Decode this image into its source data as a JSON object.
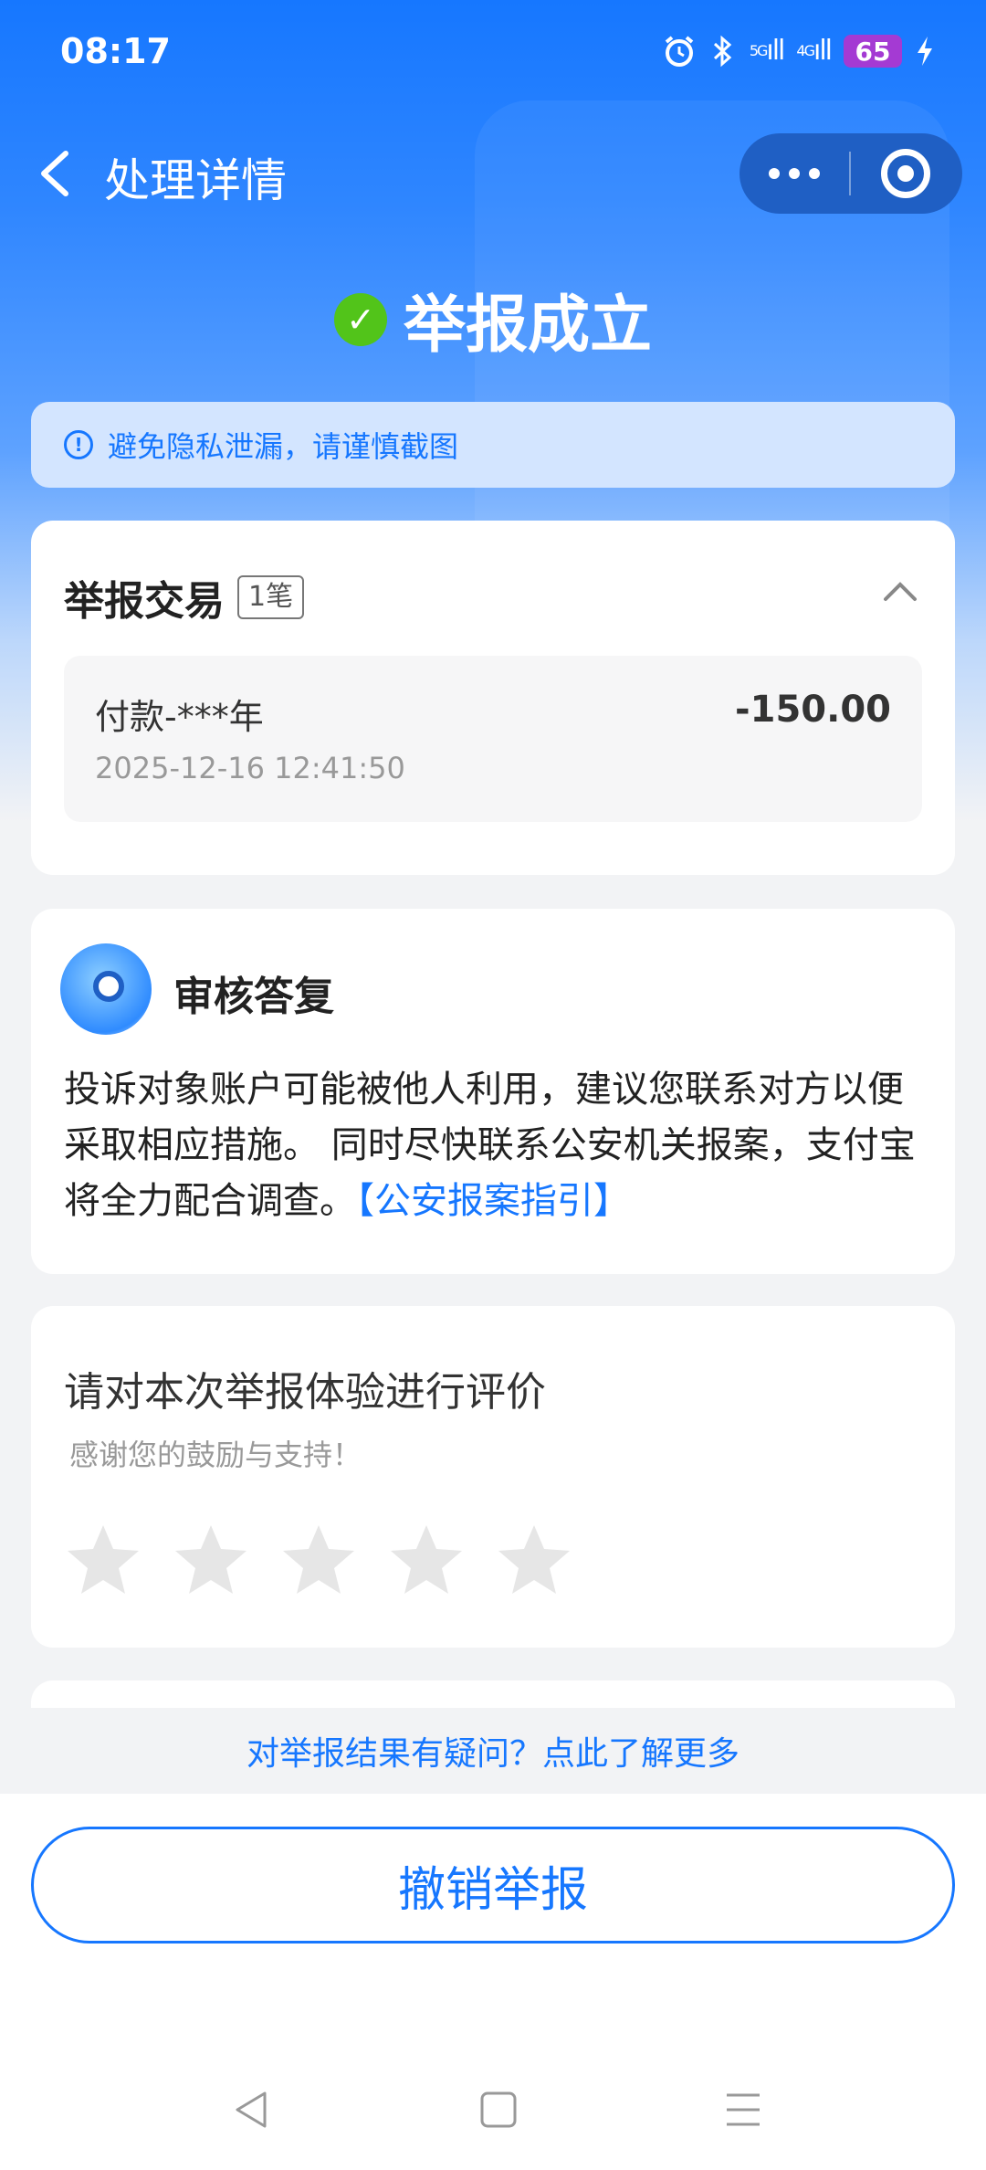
{
  "status_bar": {
    "time": "08:17",
    "sig1_label": "5G",
    "sig2_label": "4G",
    "battery": "65"
  },
  "nav": {
    "title": "处理详情"
  },
  "result": {
    "title": "举报成立"
  },
  "tip": {
    "text": "避免隐私泄漏，请谨慎截图"
  },
  "transaction_card": {
    "title": "举报交易",
    "count": "1笔",
    "item": {
      "name": "付款-***年",
      "amount": "-150.00",
      "time": "2025-12-16 12:41:50"
    }
  },
  "review_card": {
    "title": "审核答复",
    "body": "投诉对象账户可能被他人利用，建议您联系对方以便采取相应措施。 同时尽快联系公安机关报案，支付宝将全力配合调查。",
    "link": "【公安报案指引】"
  },
  "rating_card": {
    "title": "请对本次举报体验进行评价",
    "subtitle": "感谢您的鼓励与支持！",
    "stars_selected": 0,
    "stars_total": 5
  },
  "footer": {
    "link": "对举报结果有疑问？点此了解更多",
    "revoke_button": "撤销举报"
  },
  "colors": {
    "accent": "#1677ff",
    "success": "#52c41a",
    "battery": "#a43ad3"
  },
  "icons": [
    "alarm-icon",
    "bluetooth-icon",
    "signal-icon",
    "battery-icon",
    "back-arrow-icon",
    "more-dots-icon",
    "target-icon",
    "check-circle-icon",
    "info-icon",
    "chevron-up-icon",
    "robot-avatar",
    "star-icon",
    "nav-back-icon",
    "nav-home-icon",
    "nav-menu-icon"
  ]
}
